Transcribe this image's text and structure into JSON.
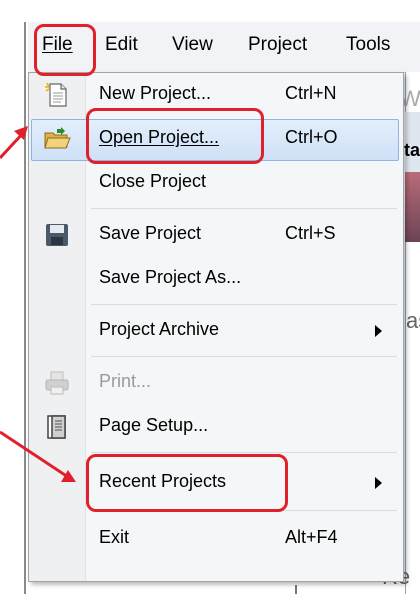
{
  "menubar": {
    "items": [
      {
        "label": "File"
      },
      {
        "label": "Edit"
      },
      {
        "label": "View"
      },
      {
        "label": "Project"
      },
      {
        "label": "Tools"
      }
    ]
  },
  "background": {
    "text_top": "W",
    "text_tab": "ta",
    "text_side": "as",
    "text_bottom": "Re"
  },
  "menu": {
    "items": [
      {
        "label": "New Project...",
        "shortcut": "Ctrl+N",
        "icon": "new-project-icon"
      },
      {
        "label": "Open Project...",
        "shortcut": "Ctrl+O",
        "icon": "open-folder-icon",
        "highlighted": true
      },
      {
        "label": "Close Project",
        "shortcut": ""
      },
      {
        "label": "Save Project",
        "shortcut": "Ctrl+S",
        "icon": "save-icon"
      },
      {
        "label": "Save Project As...",
        "shortcut": ""
      },
      {
        "label": "Project Archive",
        "shortcut": "",
        "submenu": true
      },
      {
        "label": "Print...",
        "shortcut": "",
        "icon": "print-icon",
        "disabled": true
      },
      {
        "label": "Page Setup...",
        "shortcut": "",
        "icon": "page-setup-icon"
      },
      {
        "label": "Recent Projects",
        "shortcut": "",
        "submenu": true
      },
      {
        "label": "Exit",
        "shortcut": "Alt+F4"
      }
    ]
  },
  "colors": {
    "annotation": "#e0202a",
    "highlight": "#cfe1f7"
  }
}
